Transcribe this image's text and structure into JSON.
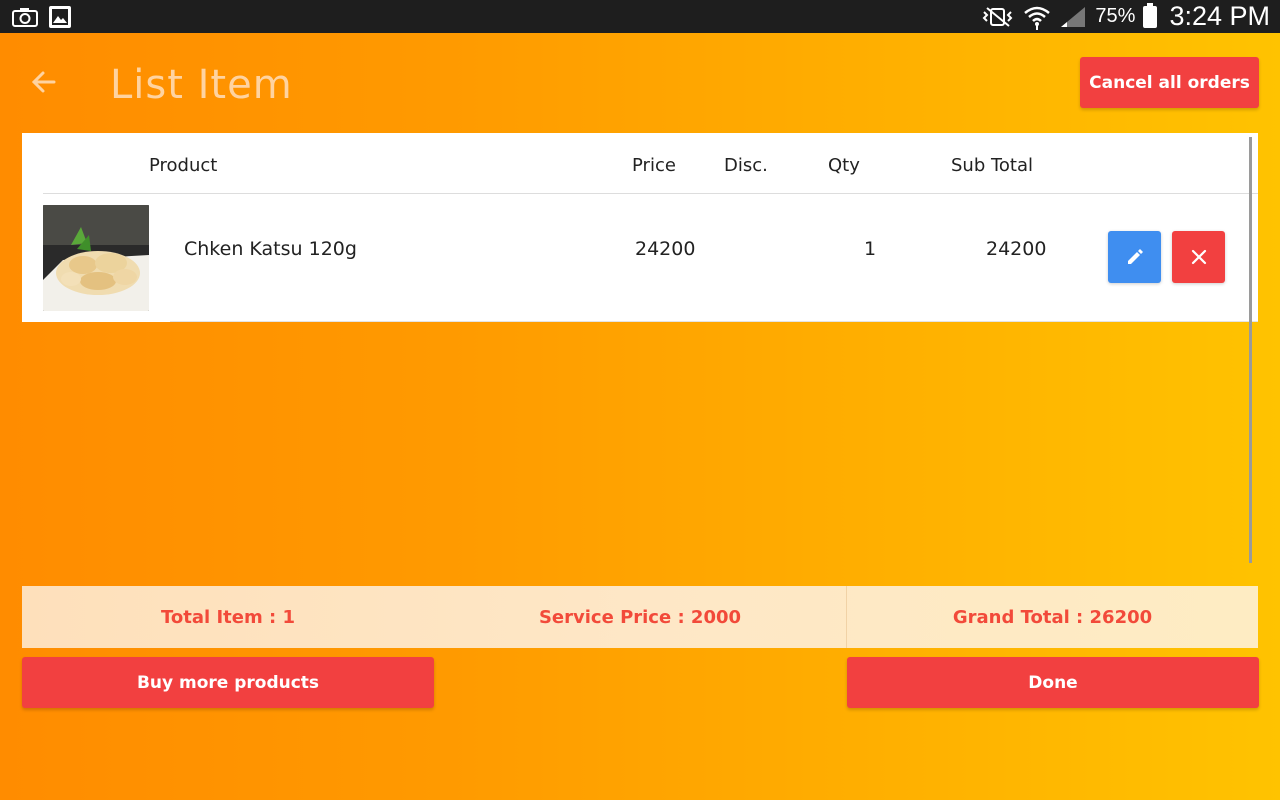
{
  "status_bar": {
    "battery_percent": "75%",
    "time": "3:24 PM",
    "icons": [
      "camera-icon",
      "image-icon",
      "vibrate-mute-icon",
      "wifi-icon",
      "signal-icon",
      "battery-icon"
    ]
  },
  "header": {
    "title": "List Item",
    "back_icon": "arrow-left-icon",
    "cancel_label": "Cancel all orders"
  },
  "table": {
    "columns": [
      "Product",
      "Price",
      "Disc.",
      "Qty",
      "Sub Total"
    ],
    "rows": [
      {
        "product": "Chken Katsu 120g",
        "price": "24200",
        "disc": "",
        "qty": "1",
        "subtotal": "24200",
        "thumbnail": "food-photo"
      }
    ]
  },
  "summary": {
    "total_item": "Total Item : 1",
    "service_price": "Service Price : 2000",
    "grand_total": "Grand Total : 26200"
  },
  "actions": {
    "buy_more_label": "Buy more products",
    "done_label": "Done"
  },
  "colors": {
    "accent_red": "#f24040",
    "edit_blue": "#3f8ef0",
    "summary_text": "#f24a3a"
  }
}
